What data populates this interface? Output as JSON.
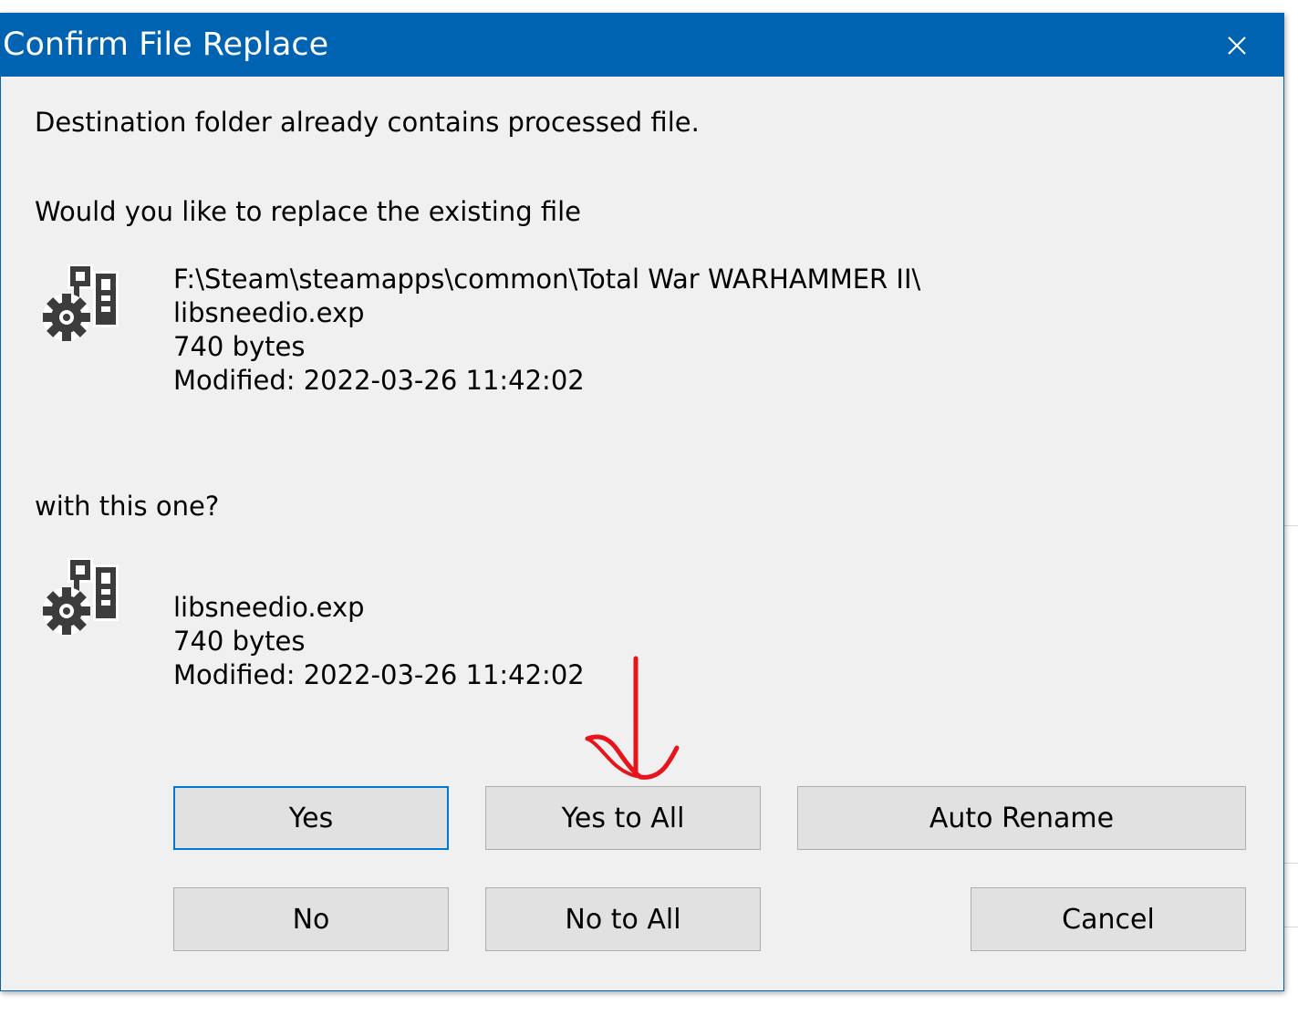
{
  "dialog": {
    "title": "Confirm File Replace",
    "message": "Destination folder already contains processed file.",
    "question": "Would you like to replace the existing file",
    "existing_file": {
      "path": "F:\\Steam\\steamapps\\common\\Total War WARHAMMER II\\",
      "name": "libsneedio.exp",
      "size": "740 bytes",
      "modified": "Modified: 2022-03-26 11:42:02"
    },
    "with_text": "with this one?",
    "new_file": {
      "name": "libsneedio.exp",
      "size": "740 bytes",
      "modified": "Modified: 2022-03-26 11:42:02"
    },
    "buttons": {
      "yes": "Yes",
      "yes_to_all": "Yes to All",
      "auto_rename": "Auto Rename",
      "no": "No",
      "no_to_all": "No to All",
      "cancel": "Cancel"
    }
  },
  "icons": {
    "close": "close-icon",
    "file": "settings-file-icon"
  },
  "colors": {
    "title_bar": "#0063b1",
    "dialog_bg": "#f0f0f0",
    "button_bg": "#e1e1e1",
    "default_button_border": "#0078d7",
    "annotation": "#e8141c"
  }
}
